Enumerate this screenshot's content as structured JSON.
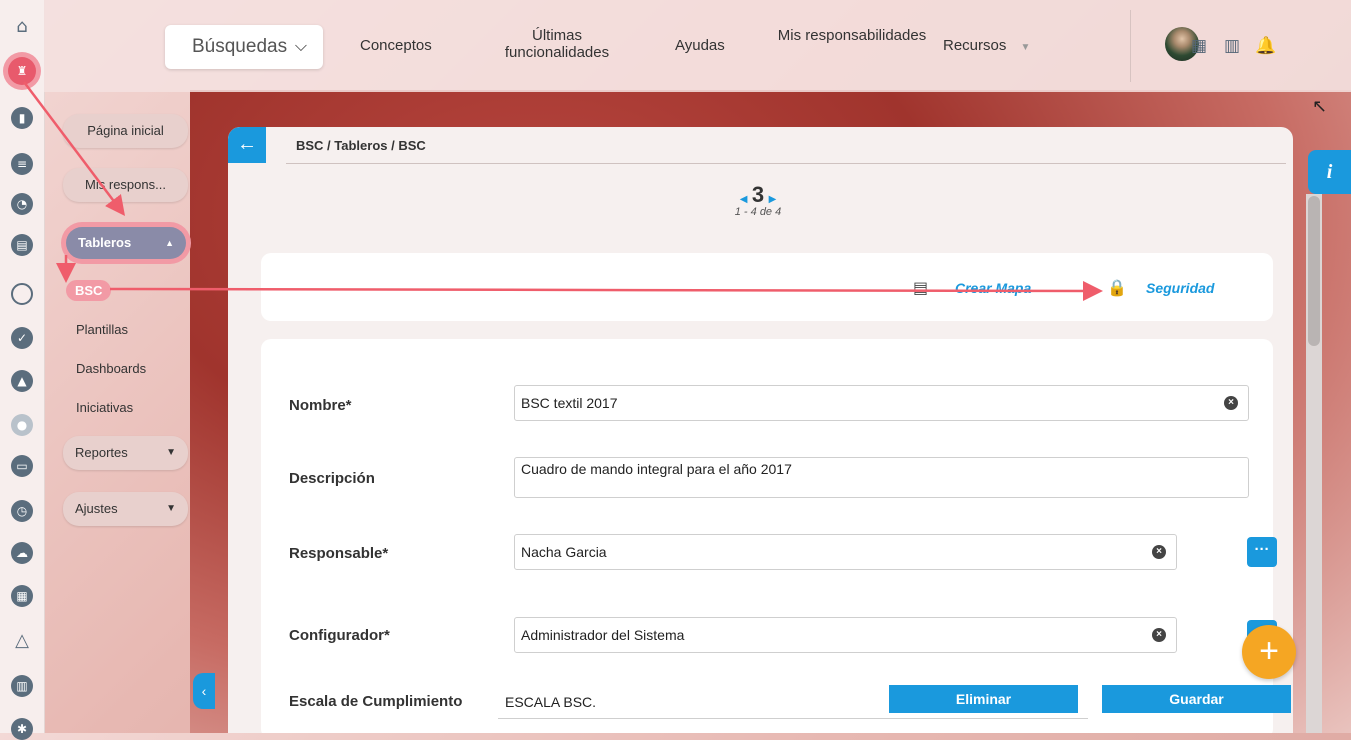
{
  "topbar": {
    "search_label": "Búsquedas",
    "nav": [
      "Conceptos",
      "Últimas funcionalidades",
      "Ayudas",
      "Mis responsabilidades",
      "Recursos"
    ]
  },
  "menu": {
    "home": "Página inicial",
    "mine": "Mis respons...",
    "tableros": "Tableros",
    "subitems": [
      "BSC",
      "Plantillas",
      "Dashboards",
      "Iniciativas"
    ],
    "reportes": "Reportes",
    "ajustes": "Ajustes"
  },
  "card": {
    "breadcrumb": "BSC / Tableros / BSC",
    "page_number": "3",
    "page_count": "1 - 4 de 4",
    "crear_mapa": "Crear Mapa",
    "seguridad": "Seguridad"
  },
  "form": {
    "nombre_label": "Nombre*",
    "nombre_value": "BSC textil 2017",
    "descripcion_label": "Descripción",
    "descripcion_value": "Cuadro de mando integral para el año 2017",
    "responsable_label": "Responsable*",
    "responsable_value": "Nacha Garcia",
    "configurador_label": "Configurador*",
    "configurador_value": "Administrador del Sistema",
    "escala_label": "Escala de Cumplimiento",
    "escala_value": "ESCALA BSC.",
    "eliminar": "Eliminar",
    "guardar": "Guardar"
  },
  "colors": {
    "accent": "#1a99dd",
    "highlight": "#f29aa5",
    "arrow": "#ef5d6b",
    "fab": "#f5a623"
  }
}
